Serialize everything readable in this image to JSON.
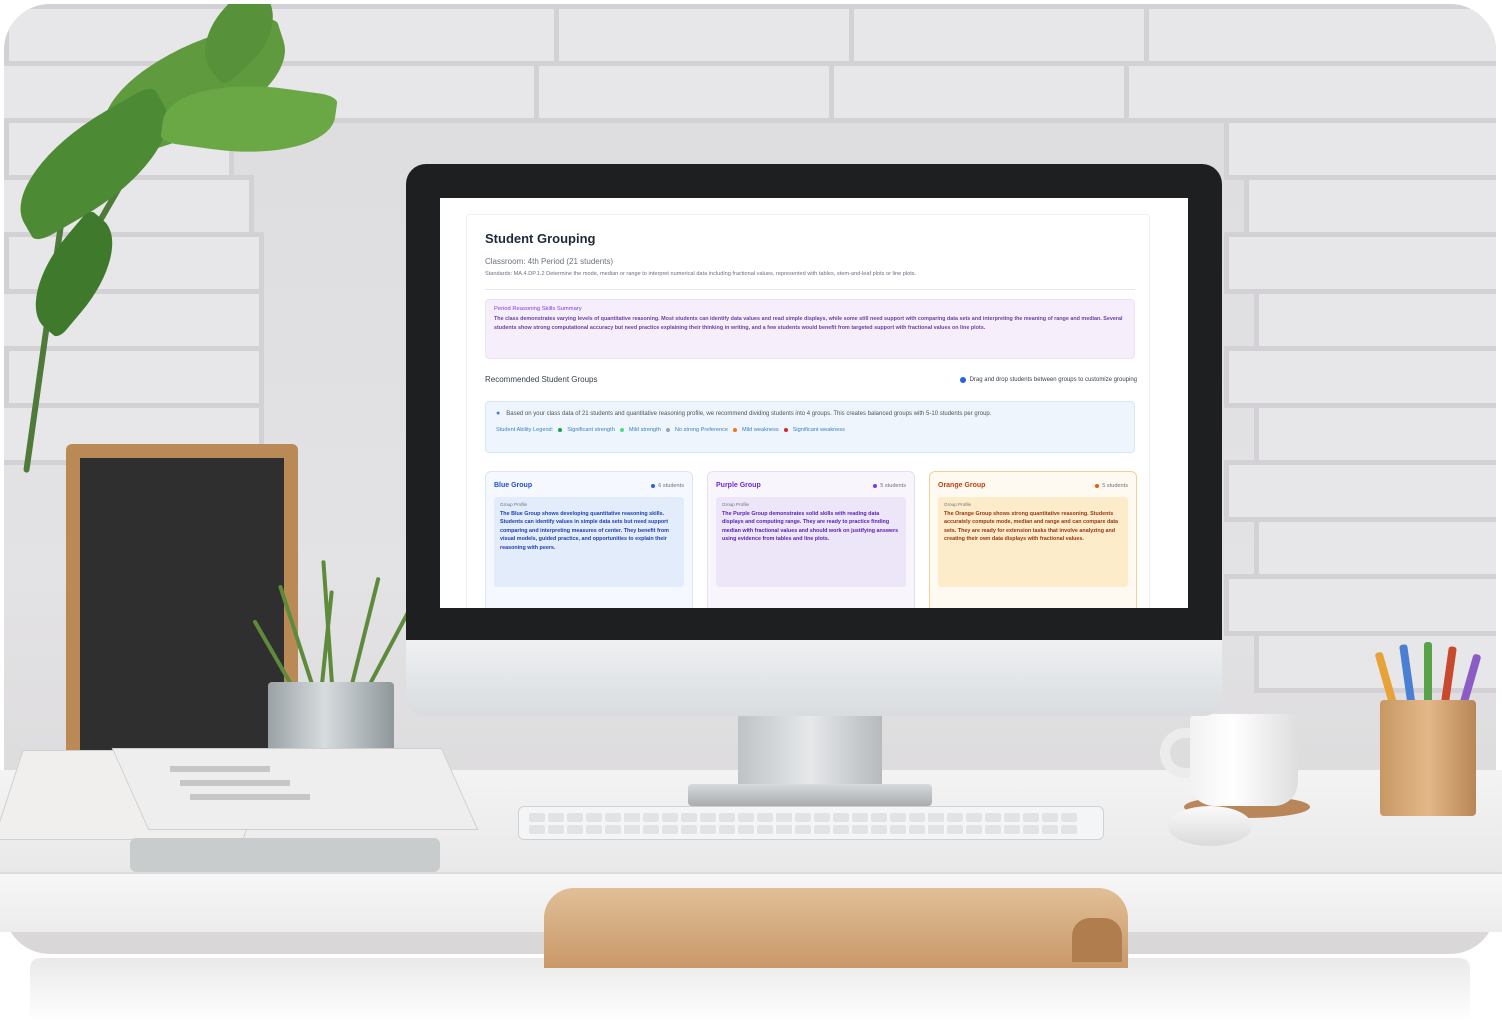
{
  "app": {
    "title": "Student Grouping",
    "classroom": "Classroom: 4th Period (21 students)",
    "standard": "Standards: MA.4.DP.1.2 Determine the mode, median or range to interpret numerical data including fractional values, represented with tables, stem-and-leaf plots or line plots."
  },
  "summary": {
    "title": "Period Reasoning Skills Summary",
    "text": "The class demonstrates varying levels of quantitative reasoning. Most students can identify data values and read simple displays, while some still need support with comparing data sets and interpreting the meaning of range and median. Several students show strong computational accuracy but need practice explaining their thinking in writing, and a few students would benefit from targeted support with fractional values on line plots."
  },
  "recommended": {
    "title": "Recommended Student Groups",
    "drag_hint": "Drag and drop students between groups to customize grouping"
  },
  "info": {
    "text": "Based on your class data of 21 students and quantitative reasoning profile, we recommend dividing students into 4 groups. This creates balanced groups with 5-10 students per group.",
    "legend_label": "Student Ability Legend:",
    "legend_items": [
      "Significant strength",
      "Mild strength",
      "No strong Preference",
      "Mild weakness",
      "Significant weakness"
    ],
    "legend_colors": [
      "#16a34a",
      "#4ade80",
      "#9ca3af",
      "#f97316",
      "#dc2626"
    ]
  },
  "groups": [
    {
      "name": "Blue Group",
      "count": "6 students",
      "color": "#1d4ed8",
      "profile_label": "Group Profile",
      "profile": "The Blue Group shows developing quantitative reasoning skills. Students can identify values in simple data sets but need support comparing and interpreting measures of center. They benefit from visual models, guided practice, and opportunities to explain their reasoning with peers."
    },
    {
      "name": "Purple Group",
      "count": "5 students",
      "color": "#6d28d9",
      "profile_label": "Group Profile",
      "profile": "The Purple Group demonstrates solid skills with reading data displays and computing range. They are ready to practice finding median with fractional values and should work on justifying answers using evidence from tables and line plots."
    },
    {
      "name": "Orange Group",
      "count": "5 students",
      "color": "#c2410c",
      "profile_label": "Group Profile",
      "profile": "The Orange Group shows strong quantitative reasoning. Students accurately compute mode, median and range and can compare data sets. They are ready for extension tasks that involve analyzing and creating their own data displays with fractional values."
    }
  ]
}
